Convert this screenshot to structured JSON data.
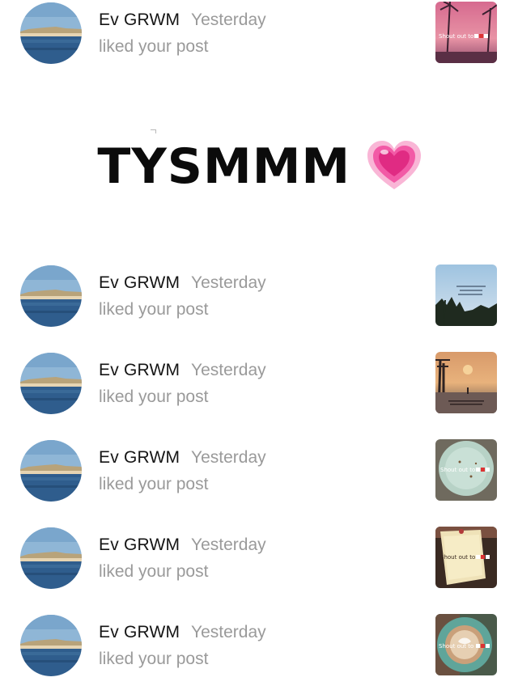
{
  "banner": {
    "text": "TYSMMM",
    "emoji_icon": "growing-heart-icon",
    "emoji_color": "#f25aa6"
  },
  "notifications": [
    {
      "username": "Ev GRWM",
      "time": "Yesterday",
      "action": "liked your post",
      "thumb_icon": "sunset-palm-thumbnail",
      "thumb_caption": "Shout out to"
    },
    {
      "username": "Ev GRWM",
      "time": "Yesterday",
      "action": "liked your post",
      "thumb_icon": "palm-sky-thumbnail",
      "thumb_caption": ""
    },
    {
      "username": "Ev GRWM",
      "time": "Yesterday",
      "action": "liked your post",
      "thumb_icon": "sunset-pier-thumbnail",
      "thumb_caption": ""
    },
    {
      "username": "Ev GRWM",
      "time": "Yesterday",
      "action": "liked your post",
      "thumb_icon": "plate-thumbnail",
      "thumb_caption": "Shout out to"
    },
    {
      "username": "Ev GRWM",
      "time": "Yesterday",
      "action": "liked your post",
      "thumb_icon": "dessert-thumbnail",
      "thumb_caption": "Shout out to"
    },
    {
      "username": "Ev GRWM",
      "time": "Yesterday",
      "action": "liked your post",
      "thumb_icon": "coffee-thumbnail",
      "thumb_caption": "Shout out to"
    }
  ],
  "colors": {
    "username": "#151515",
    "secondary_text": "#9a9a9a",
    "background": "#ffffff"
  }
}
